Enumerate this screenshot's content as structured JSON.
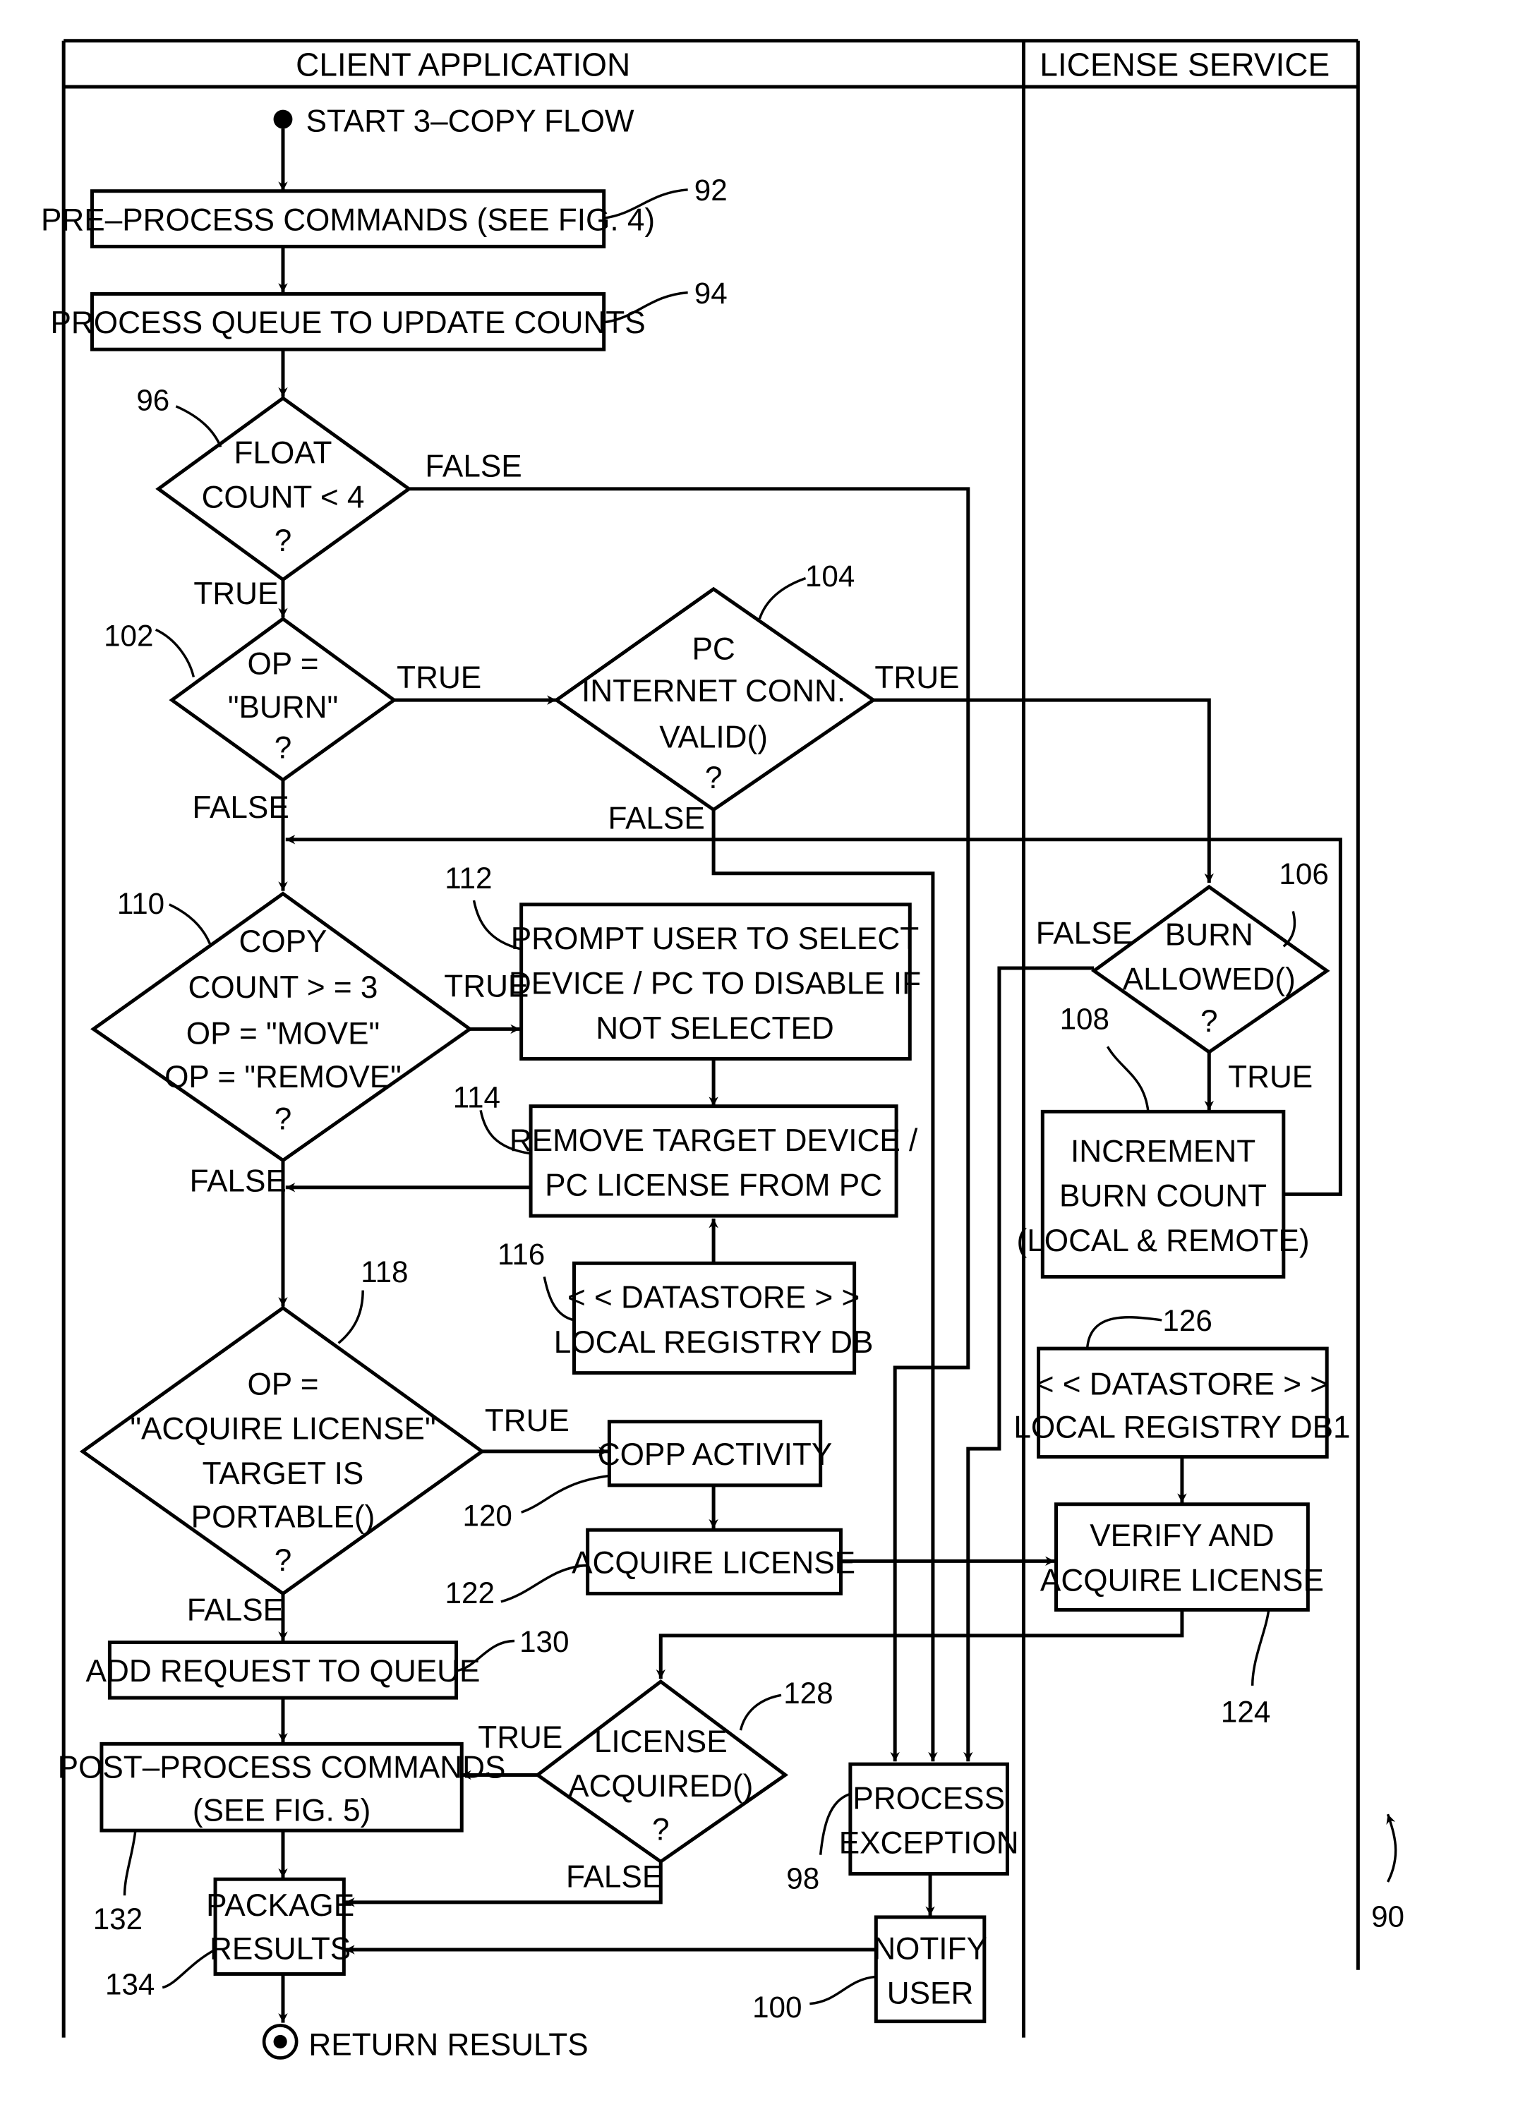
{
  "figure_ref": "90",
  "lanes": {
    "client": "CLIENT APPLICATION",
    "service": "LICENSE SERVICE"
  },
  "start": "START 3–COPY FLOW",
  "end": "RETURN RESULTS",
  "nodes": {
    "n92": {
      "ref": "92",
      "lines": [
        "PRE–PROCESS COMMANDS (SEE FIG. 4)"
      ]
    },
    "n94": {
      "ref": "94",
      "lines": [
        "PROCESS QUEUE TO UPDATE COUNTS"
      ]
    },
    "n96": {
      "ref": "96",
      "lines": [
        "FLOAT",
        "COUNT < 4",
        "?"
      ]
    },
    "n102": {
      "ref": "102",
      "lines": [
        "OP =",
        "\"BURN\"",
        "?"
      ]
    },
    "n104": {
      "ref": "104",
      "lines": [
        "PC",
        "INTERNET CONN.",
        "VALID()",
        "?"
      ]
    },
    "n106": {
      "ref": "106",
      "lines": [
        "BURN",
        "ALLOWED()",
        "?"
      ]
    },
    "n108": {
      "ref": "108",
      "lines": [
        "INCREMENT",
        "BURN COUNT",
        "(LOCAL & REMOTE)"
      ]
    },
    "n110": {
      "ref": "110",
      "lines": [
        "COPY",
        "COUNT > = 3",
        "OP = \"MOVE\"",
        "OP = \"REMOVE\"",
        "?"
      ]
    },
    "n112": {
      "ref": "112",
      "lines": [
        "PROMPT USER TO SELECT",
        "DEVICE / PC TO DISABLE IF",
        "NOT SELECTED"
      ]
    },
    "n114": {
      "ref": "114",
      "lines": [
        "REMOVE TARGET DEVICE /",
        "PC LICENSE FROM PC"
      ]
    },
    "n116": {
      "ref": "116",
      "lines": [
        "< < DATASTORE > >",
        "LOCAL REGISTRY DB"
      ]
    },
    "n118": {
      "ref": "118",
      "lines": [
        "OP =",
        "\"ACQUIRE LICENSE\"",
        "TARGET IS",
        "PORTABLE()",
        "?"
      ]
    },
    "n120": {
      "ref": "120",
      "lines": [
        "COPP ACTIVITY"
      ]
    },
    "n122": {
      "ref": "122",
      "lines": [
        "ACQUIRE LICENSE"
      ]
    },
    "n124": {
      "ref": "124",
      "lines": [
        "VERIFY AND",
        "ACQUIRE LICENSE"
      ]
    },
    "n126": {
      "ref": "126",
      "lines": [
        "< < DATASTORE > >",
        "LOCAL REGISTRY DB1"
      ]
    },
    "n128": {
      "ref": "128",
      "lines": [
        "LICENSE",
        "ACQUIRED()",
        "?"
      ]
    },
    "n130": {
      "ref": "130",
      "lines": [
        "ADD REQUEST TO QUEUE"
      ]
    },
    "n132": {
      "ref": "132",
      "lines": [
        "POST–PROCESS COMMANDS",
        "(SEE FIG. 5)"
      ]
    },
    "n134": {
      "ref": "134",
      "lines": [
        "PACKAGE",
        "RESULTS"
      ]
    },
    "n98": {
      "ref": "98",
      "lines": [
        "PROCESS",
        "EXCEPTION"
      ]
    },
    "n100": {
      "ref": "100",
      "lines": [
        "NOTIFY",
        "USER"
      ]
    }
  },
  "edge_labels": {
    "n96_false": "FALSE",
    "n96_true": "TRUE",
    "n102_true": "TRUE",
    "n102_false": "FALSE",
    "n104_true": "TRUE",
    "n104_false": "FALSE",
    "n106_false": "FALSE",
    "n106_true": "TRUE",
    "n110_true": "TRUE",
    "n110_false": "FALSE",
    "n118_true": "TRUE",
    "n118_false": "FALSE",
    "n128_true": "TRUE",
    "n128_false": "FALSE"
  }
}
